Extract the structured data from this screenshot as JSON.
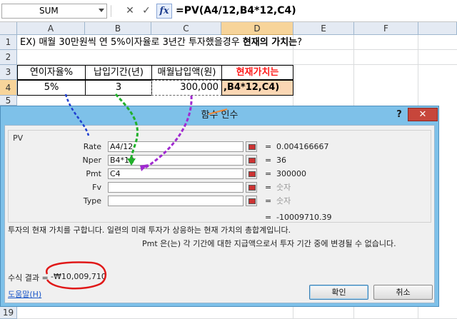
{
  "formula_bar": {
    "name_box": "SUM",
    "cancel_icon": "cancel-x-icon",
    "enter_icon": "checkmark-icon",
    "fx_label": "fx",
    "formula": "=PV(A4/12,B4*12,C4)"
  },
  "grid": {
    "columns": [
      "A",
      "B",
      "C",
      "D",
      "E",
      "F"
    ],
    "rows": [
      "1",
      "2",
      "3",
      "4",
      "5",
      "19"
    ],
    "title_prefix": "EX) 매월 30만원씩 연 5%이자율로 3년간 투자했을경우 ",
    "title_bold": "현재의 가치는",
    "title_suffix": "?",
    "headers": {
      "a3": "연이자율%",
      "b3": "납입기간(년)",
      "c3": "매월납입액(원)",
      "d3": "현재가치는"
    },
    "values": {
      "a4": "5%",
      "b4": "3",
      "c4": "300,000",
      "d4": ",B4*12,C4)"
    }
  },
  "dialog": {
    "title": "함수 인수",
    "help_icon": "?",
    "close_icon": "✕",
    "function_name": "PV",
    "args": [
      {
        "label": "Rate",
        "input": "A4/12",
        "value": "0.004166667",
        "muted": false
      },
      {
        "label": "Nper",
        "input": "B4*12",
        "value": "36",
        "muted": false
      },
      {
        "label": "Pmt",
        "input": "C4",
        "value": "300000",
        "muted": false
      },
      {
        "label": "Fv",
        "input": "",
        "value": "숫자",
        "muted": true
      },
      {
        "label": "Type",
        "input": "",
        "value": "숫자",
        "muted": true
      }
    ],
    "equals": "=",
    "result_value": "-10009710.39",
    "description": "투자의 현재 가치를 구합니다. 일련의 미래 투자가 상응하는 현재 가치의 총합계입니다.",
    "arg_description": "Pmt  은(는) 각 기간에 대한 지급액으로서 투자 기간 중에 변경될 수 없습니다.",
    "formula_result_label": "수식 결과 =",
    "formula_result": "-₩10,009,710",
    "help_link": "도움말(H)",
    "ok_label": "확인",
    "cancel_label": "취소"
  },
  "colors": {
    "dialog_frame": "#7ec1e9",
    "selected_header": "#f7d49a",
    "d4_fill": "#fbd7b4",
    "d3_text": "#ff1a1a",
    "annotation_blue": "#1f3fd0",
    "annotation_green": "#20b02a",
    "annotation_purple": "#a02ad0",
    "annotation_orange": "#f08a3a",
    "annotation_red": "#e01818"
  }
}
